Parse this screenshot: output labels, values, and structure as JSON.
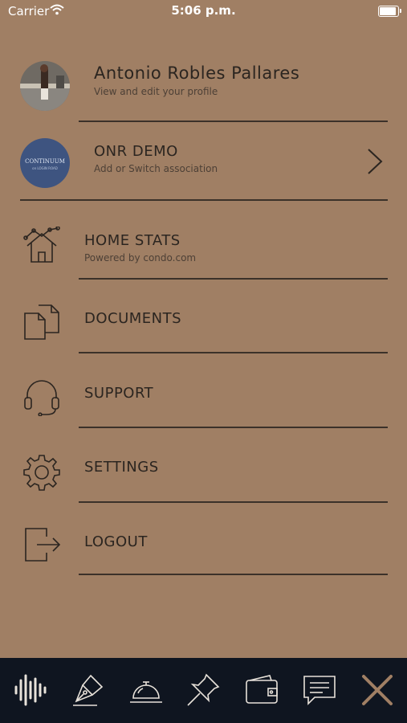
{
  "status_bar": {
    "carrier": "Carrier",
    "time": "5:06 p.m.",
    "battery_level": 1.0
  },
  "profile": {
    "name": "Antonio  Robles Pallares",
    "subtitle": "View and edit your profile"
  },
  "association": {
    "name": "ONR DEMO",
    "subtitle": "Add or Switch association",
    "logo_text": "CONTINUUM",
    "logo_subtext": "on LOGIN ROAD"
  },
  "menu": [
    {
      "label": "HOME STATS",
      "subtitle": "Powered by condo.com",
      "icon": "home-stats-icon"
    },
    {
      "label": "DOCUMENTS",
      "icon": "documents-icon"
    },
    {
      "label": "SUPPORT",
      "icon": "headset-icon"
    },
    {
      "label": "SETTINGS",
      "icon": "gear-icon"
    },
    {
      "label": "LOGOUT",
      "icon": "logout-icon"
    }
  ],
  "tab_bar": {
    "icons": [
      "sound-wave-icon",
      "pen-nib-icon",
      "service-bell-icon",
      "pushpin-icon",
      "wallet-icon",
      "chat-icon",
      "close-icon"
    ],
    "colors": {
      "background": "#0f1520",
      "icon": "#e8e2da",
      "close": "#a07f64"
    }
  },
  "colors": {
    "background": "#a07f64",
    "text": "#2b2520",
    "divider": "#3b3129"
  }
}
